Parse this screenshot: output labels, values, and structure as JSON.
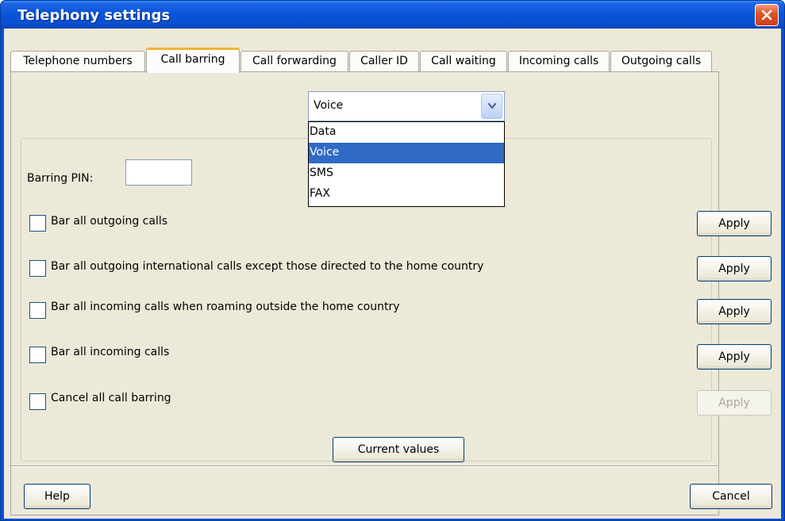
{
  "window": {
    "title": "Telephony settings"
  },
  "tabs": [
    {
      "label": "Telephone numbers",
      "active": false
    },
    {
      "label": "Call barring",
      "active": true
    },
    {
      "label": "Call forwarding",
      "active": false
    },
    {
      "label": "Caller ID",
      "active": false
    },
    {
      "label": "Call waiting",
      "active": false
    },
    {
      "label": "Incoming calls",
      "active": false
    },
    {
      "label": "Outgoing calls",
      "active": false
    }
  ],
  "service_select": {
    "value": "Voice",
    "options": [
      "Data",
      "Voice",
      "SMS",
      "FAX"
    ],
    "highlighted": "Voice"
  },
  "barring_pin": {
    "label": "Barring PIN:",
    "value": ""
  },
  "barring_rows": [
    {
      "label": "Bar all outgoing calls",
      "checked": false,
      "apply_label": "Apply",
      "apply_enabled": true
    },
    {
      "label": "Bar all outgoing international calls except those directed to the home country",
      "checked": false,
      "apply_label": "Apply",
      "apply_enabled": true
    },
    {
      "label": "Bar all incoming calls when roaming outside the home country",
      "checked": false,
      "apply_label": "Apply",
      "apply_enabled": true
    },
    {
      "label": "Bar all incoming calls",
      "checked": false,
      "apply_label": "Apply",
      "apply_enabled": true
    },
    {
      "label": "Cancel all call barring",
      "checked": false,
      "apply_label": "Apply",
      "apply_enabled": false
    }
  ],
  "buttons": {
    "current_values": "Current values",
    "help": "Help",
    "cancel": "Cancel"
  },
  "colors": {
    "titlebar": "#0a4fd0",
    "selection": "#316ac5",
    "dialog_bg": "#ece9d8",
    "active_tab_accent": "#f0b431",
    "close_button": "#d23d12"
  }
}
